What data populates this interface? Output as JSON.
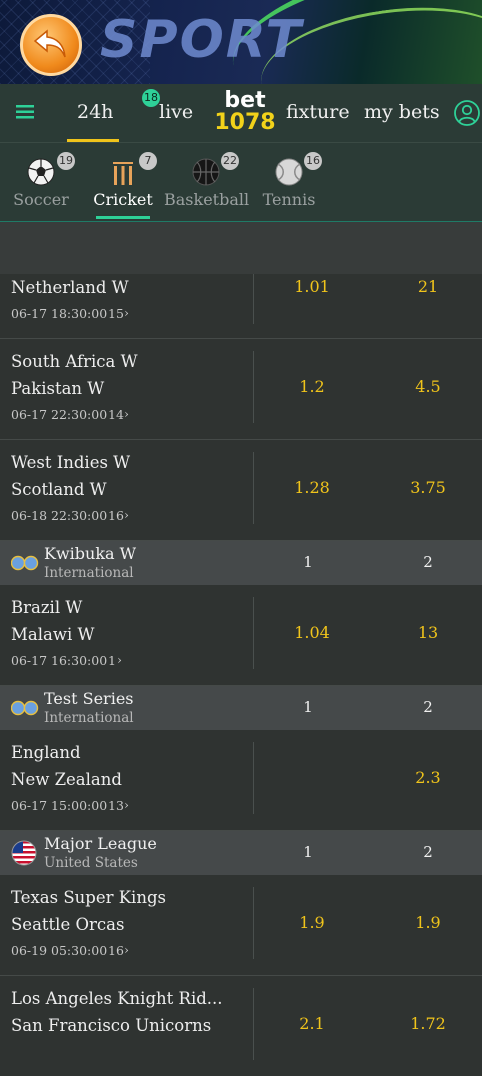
{
  "banner": {
    "title": "SPORT"
  },
  "nav": {
    "tabs": [
      {
        "label": "24h"
      },
      {
        "label": "live",
        "badge": "18"
      },
      {
        "label": "fixture"
      },
      {
        "label": "my bets"
      }
    ],
    "logo": {
      "line1": "bet",
      "line2": "1078"
    }
  },
  "sports": [
    {
      "label": "Soccer",
      "count": "19"
    },
    {
      "label": "Cricket",
      "count": "7"
    },
    {
      "label": "Basketball",
      "count": "22"
    },
    {
      "label": "Tennis",
      "count": "16"
    }
  ],
  "matches": {
    "m1": {
      "team2": "Netherland W",
      "time": "06-17 18:30:00",
      "markets": "15",
      "odd1": "1.01",
      "odd2": "21"
    },
    "m2": {
      "team1": "South Africa W",
      "team2": "Pakistan W",
      "time": "06-17 22:30:00",
      "markets": "14",
      "odd1": "1.2",
      "odd2": "4.5"
    },
    "m3": {
      "team1": "West Indies W",
      "team2": "Scotland W",
      "time": "06-18 22:30:00",
      "markets": "16",
      "odd1": "1.28",
      "odd2": "3.75"
    },
    "m4": {
      "team1": "Brazil W",
      "team2": "Malawi W",
      "time": "06-17 16:30:00",
      "markets": "1",
      "odd1": "1.04",
      "odd2": "13"
    },
    "m5": {
      "team1": "England",
      "team2": "New Zealand",
      "time": "06-17 15:00:00",
      "markets": "13",
      "odd1": "",
      "odd2": "2.3"
    },
    "m6": {
      "team1": "Texas Super Kings",
      "team2": "Seattle Orcas",
      "time": "06-19 05:30:00",
      "markets": "16",
      "odd1": "1.9",
      "odd2": "1.9"
    },
    "m7": {
      "team1": "Los Angeles Knight Rid...",
      "team2": "San Francisco Unicorns",
      "odd1": "2.1",
      "odd2": "1.72"
    }
  },
  "leagues": {
    "l1": {
      "name": "Kwibuka W",
      "region": "International",
      "h1": "1",
      "h2": "2"
    },
    "l2": {
      "name": "Test Series",
      "region": "International",
      "h1": "1",
      "h2": "2"
    },
    "l3": {
      "name": "Major League",
      "region": "United States",
      "h1": "1",
      "h2": "2"
    }
  },
  "colors": {
    "accent": "#2ed198",
    "odds": "#f0c41b",
    "header_bg": "#2b3b36"
  }
}
